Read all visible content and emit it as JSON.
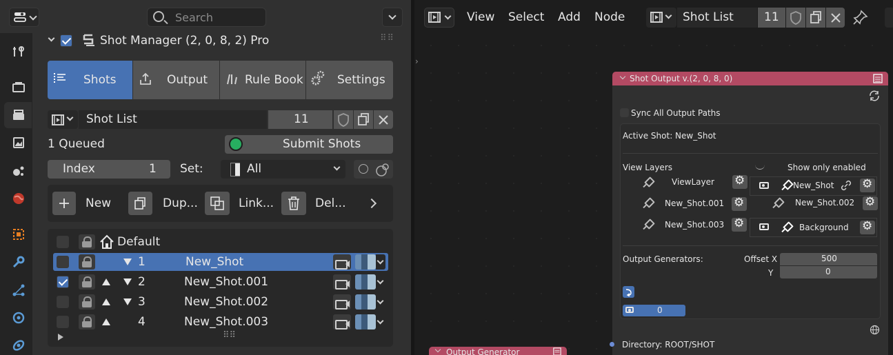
{
  "left_header": {
    "search_placeholder": "Search"
  },
  "panel": {
    "title": "Shot Manager (2, 0, 8, 2) Pro",
    "enabled": true,
    "tabs": [
      {
        "label": "Shots",
        "icon": "shots-icon",
        "active": true
      },
      {
        "label": "Output",
        "icon": "export-icon",
        "active": false
      },
      {
        "label": "Rule Book",
        "icon": "rulebook-icon",
        "active": false
      },
      {
        "label": "Settings",
        "icon": "settings-icon",
        "active": false
      }
    ],
    "shot_list": {
      "name": "Shot List",
      "users": "11"
    },
    "queued_text": "1 Queued",
    "submit_label": "Submit Shots",
    "index_label": "Index",
    "index_value": "1",
    "set_label": "Set:",
    "set_value": "All",
    "actions": [
      {
        "label": "New",
        "icon": "plus-icon"
      },
      {
        "label": "Dup...",
        "icon": "duplicate-icon"
      },
      {
        "label": "Link...",
        "icon": "link-icon"
      },
      {
        "label": "Del...",
        "icon": "trash-icon"
      }
    ],
    "default_row": "Default",
    "shots": [
      {
        "index": "1",
        "name": "New_Shot",
        "checked": false,
        "selected": true,
        "up": false,
        "down": true
      },
      {
        "index": "2",
        "name": "New_Shot.001",
        "checked": true,
        "selected": false,
        "up": true,
        "down": true
      },
      {
        "index": "3",
        "name": "New_Shot.002",
        "checked": false,
        "selected": false,
        "up": true,
        "down": true
      },
      {
        "index": "4",
        "name": "New_Shot.003",
        "checked": false,
        "selected": false,
        "up": true,
        "down": false
      }
    ]
  },
  "node_editor": {
    "menus": [
      "View",
      "Select",
      "Add",
      "Node"
    ],
    "datablock": {
      "name": "Shot List",
      "users": "11"
    }
  },
  "node": {
    "title": "Shot Output v.(2, 0, 8, 0)",
    "sync_label": "Sync All Output Paths",
    "active_shot": "Active Shot: New_Shot",
    "view_layers_label": "View Layers",
    "show_enabled_label": "Show only enabled",
    "view_layers": [
      "ViewLayer",
      "New_Shot.001",
      "New_Shot.003"
    ],
    "layers_right": [
      "New_Shot",
      "New_Shot.002",
      "Background"
    ],
    "output_generators_label": "Output Generators:",
    "offset_x_label": "Offset X",
    "offset_x": "500",
    "y_label": "Y",
    "y_value": "0",
    "camera_count": "0",
    "directory": "Directory: ROOT/SHOT"
  },
  "node2": {
    "title": "Output Generator"
  },
  "colors": {
    "accent": "#4772b3",
    "node_header": "#b34a63"
  }
}
